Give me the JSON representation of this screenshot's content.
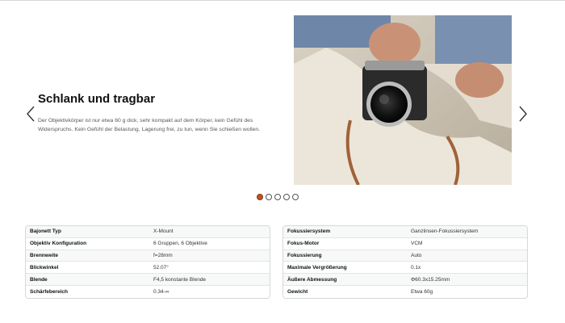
{
  "carousel": {
    "title": "Schlank und tragbar",
    "description": "Der Objektivkörper ist nur etwa 60 g dick, sehr kompakt auf dem Körper, kein Gefühl des Widerspruchs. Kein Gefühl der Belastung, Lagerung frei, zu tun, wenn Sie schießen wollen.",
    "prev_icon": "chevron-left-icon",
    "next_icon": "chevron-right-icon",
    "dots": [
      {
        "active": true
      },
      {
        "active": false
      },
      {
        "active": false
      },
      {
        "active": false
      },
      {
        "active": false
      }
    ],
    "active_dot_color": "#c7511f"
  },
  "specs_left": [
    {
      "key": "Bajonett Typ",
      "value": "X-Mount"
    },
    {
      "key": "Objektiv Konfiguration",
      "value": "6 Gruppen, 6 Objektive"
    },
    {
      "key": "Brennweite",
      "value": "f=28mm"
    },
    {
      "key": "Blickwinkel",
      "value": "52.07°"
    },
    {
      "key": "Blende",
      "value": "F4,5 konstante Blende"
    },
    {
      "key": "Schärfebereich",
      "value": "0.34-∞"
    }
  ],
  "specs_right": [
    {
      "key": "Fokussiersystem",
      "value": "Ganzlinsen-Fokussiersystem"
    },
    {
      "key": "Fokus-Motor",
      "value": "VCM"
    },
    {
      "key": "Fokussierung",
      "value": "Auto"
    },
    {
      "key": "Maximale Vergrößerung",
      "value": "0.1x"
    },
    {
      "key": "Äußere Abmessung",
      "value": "Φ60.3x15.25mm"
    },
    {
      "key": "Gewicht",
      "value": "Etwa 60g"
    }
  ]
}
